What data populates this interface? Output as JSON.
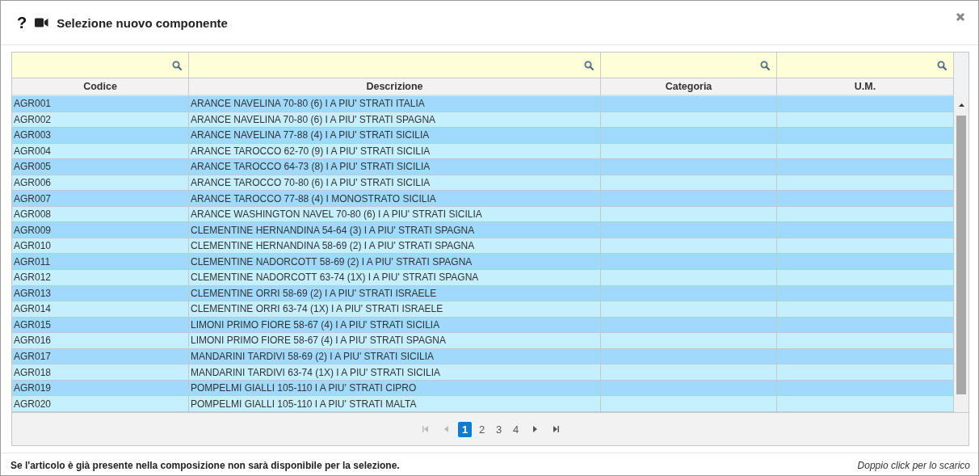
{
  "dialog": {
    "title": "Selezione nuovo componente",
    "help": "?"
  },
  "table": {
    "columns": [
      "Codice",
      "Descrizione",
      "Categoria",
      "U.M."
    ],
    "rows": [
      [
        "AGR001",
        "ARANCE NAVELINA 70-80 (6) I A PIU' STRATI ITALIA"
      ],
      [
        "AGR002",
        "ARANCE NAVELINA 70-80 (6) I A PIU' STRATI SPAGNA"
      ],
      [
        "AGR003",
        "ARANCE NAVELINA 77-88 (4) I A PIU' STRATI SICILIA"
      ],
      [
        "AGR004",
        "ARANCE TAROCCO 62-70 (9) I A PIU' STRATI SICILIA"
      ],
      [
        "AGR005",
        "ARANCE TAROCCO 64-73 (8) I A PIU' STRATI SICILIA"
      ],
      [
        "AGR006",
        "ARANCE TAROCCO 70-80 (6) I A PIU' STRATI SICILIA"
      ],
      [
        "AGR007",
        "ARANCE TAROCCO 77-88 (4) I MONOSTRATO SICILIA"
      ],
      [
        "AGR008",
        "ARANCE WASHINGTON NAVEL 70-80 (6) I A PIU' STRATI SICILIA"
      ],
      [
        "AGR009",
        "CLEMENTINE HERNANDINA 54-64 (3) I A PIU' STRATI SPAGNA"
      ],
      [
        "AGR010",
        "CLEMENTINE HERNANDINA 58-69 (2) I A PIU' STRATI SPAGNA"
      ],
      [
        "AGR011",
        "CLEMENTINE NADORCOTT 58-69 (2) I A PIU' STRATI SPAGNA"
      ],
      [
        "AGR012",
        "CLEMENTINE NADORCOTT 63-74 (1X) I A PIU' STRATI SPAGNA"
      ],
      [
        "AGR013",
        "CLEMENTINE ORRI 58-69 (2) I A PIU' STRATI ISRAELE"
      ],
      [
        "AGR014",
        "CLEMENTINE ORRI 63-74 (1X) I A PIU' STRATI ISRAELE"
      ],
      [
        "AGR015",
        "LIMONI PRIMO FIORE 58-67 (4) I A PIU' STRATI SICILIA"
      ],
      [
        "AGR016",
        "LIMONI PRIMO FIORE 58-67 (4) I A PIU' STRATI SPAGNA"
      ],
      [
        "AGR017",
        "MANDARINI TARDIVI 58-69 (2) I A PIU' STRATI SICILIA"
      ],
      [
        "AGR018",
        "MANDARINI TARDIVI 63-74 (1X) I A PIU' STRATI SICILIA"
      ],
      [
        "AGR019",
        "POMPELMI GIALLI 105-110 I A PIU' STRATI CIPRO"
      ],
      [
        "AGR020",
        "POMPELMI GIALLI 105-110 I A PIU' STRATI MALTA"
      ]
    ]
  },
  "pager": {
    "pages": [
      {
        "label": "1",
        "selected": true
      },
      {
        "label": "2",
        "selected": false
      },
      {
        "label": "3",
        "selected": false
      },
      {
        "label": "4",
        "selected": false
      }
    ]
  },
  "footer": {
    "note": "Se l'articolo è già presente nella composizione non sarà disponibile per la selezione.",
    "hint": "Doppio click per lo scarico"
  }
}
